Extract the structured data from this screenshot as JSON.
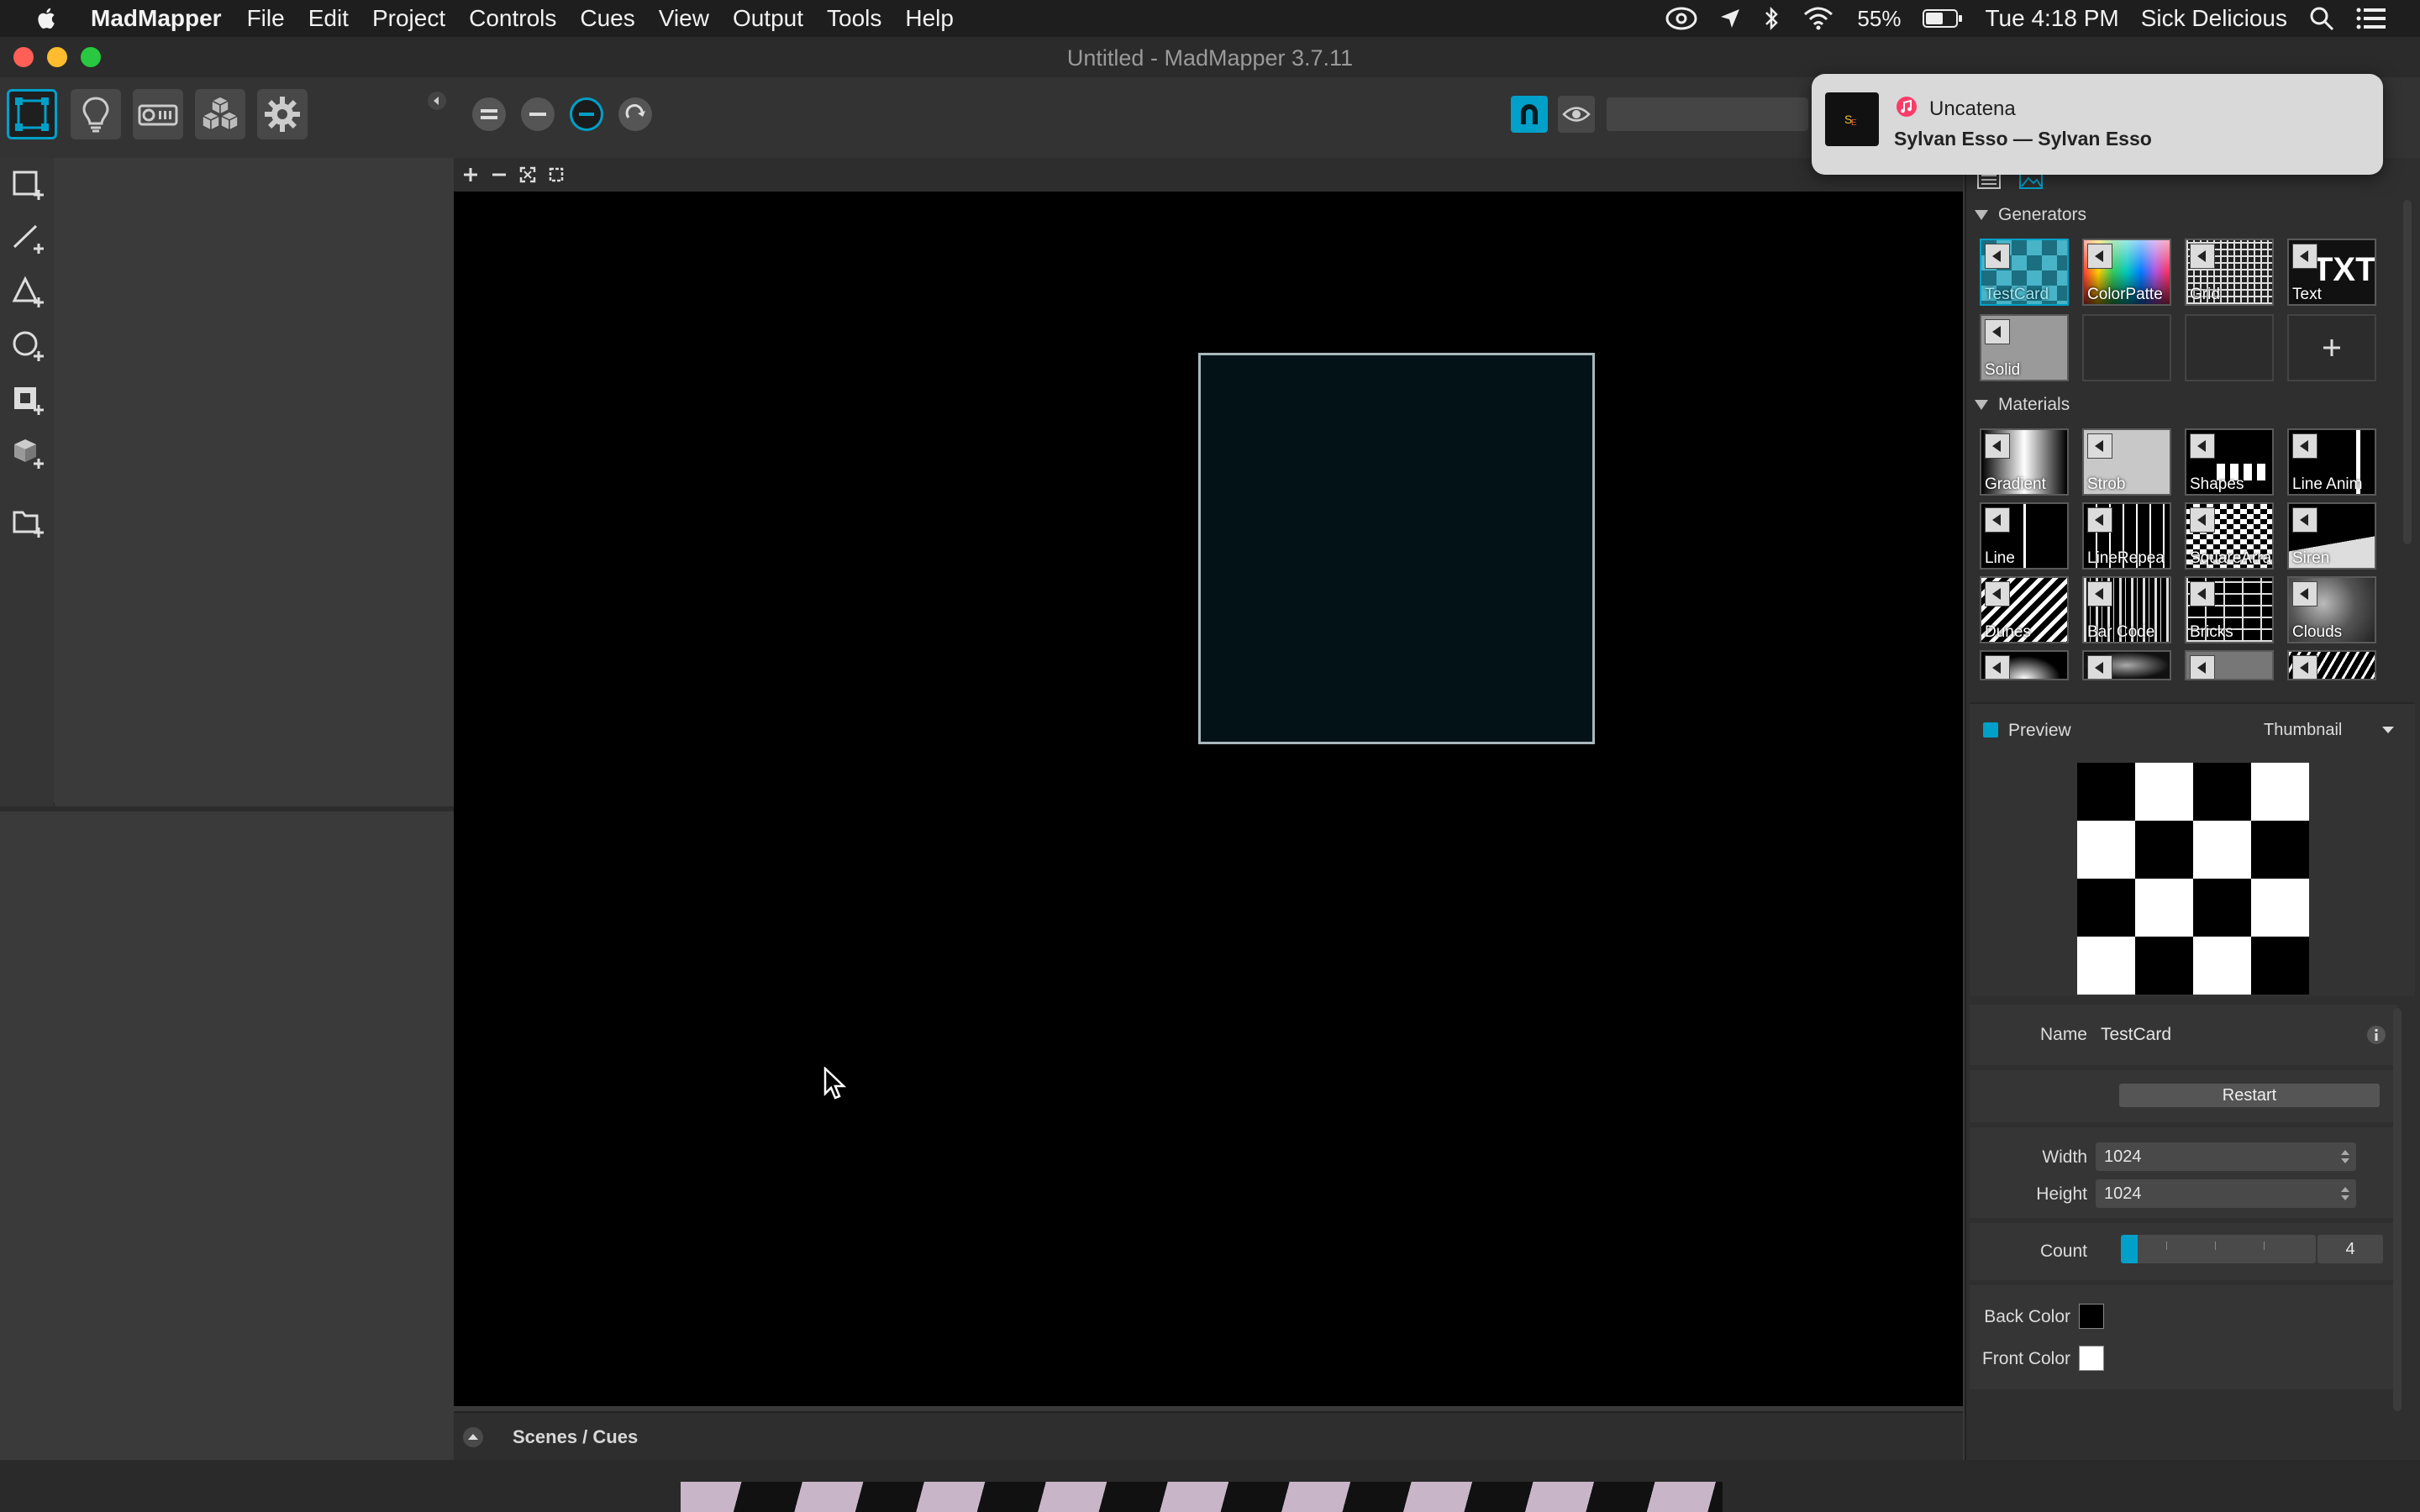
{
  "menubar": {
    "app_name": "MadMapper",
    "menus": [
      "File",
      "Edit",
      "Project",
      "Controls",
      "Cues",
      "View",
      "Output",
      "Tools",
      "Help"
    ],
    "battery": "55%",
    "clock": "Tue 4:18 PM",
    "user": "Sick Delicious"
  },
  "window": {
    "title": "Untitled - MadMapper 3.7.11"
  },
  "notification": {
    "app_icon": "music-icon",
    "title": "Uncatena",
    "subtitle": "Sylvan Esso — Sylvan Esso"
  },
  "toolbar": {
    "modes": [
      "surfaces-mode",
      "fixtures-mode",
      "projector-mode",
      "media-mode",
      "settings-mode"
    ],
    "active_mode": "surfaces-mode",
    "accent": "#00a0c8"
  },
  "right_panel": {
    "generators": {
      "title": "Generators",
      "items": [
        "TestCard",
        "ColorPatte",
        "Grid",
        "Text",
        "Solid"
      ]
    },
    "materials": {
      "title": "Materials",
      "items": [
        "Gradient",
        "Strob",
        "Shapes",
        "Line Anim",
        "Line",
        "LineRepea",
        "SquareArra",
        "Siren",
        "Dunes",
        "Bar Code",
        "Bricks",
        "Clouds"
      ]
    },
    "preview": {
      "label": "Preview",
      "mode": "Thumbnail"
    },
    "properties": {
      "name_label": "Name",
      "name_value": "TestCard",
      "restart_label": "Restart",
      "width_label": "Width",
      "width_value": "1024",
      "height_label": "Height",
      "height_value": "1024",
      "count_label": "Count",
      "count_value": "4",
      "back_color_label": "Back Color",
      "back_color": "#000000",
      "front_color_label": "Front Color",
      "front_color": "#ffffff"
    }
  },
  "canvas": {
    "scenes_label": "Scenes / Cues"
  }
}
